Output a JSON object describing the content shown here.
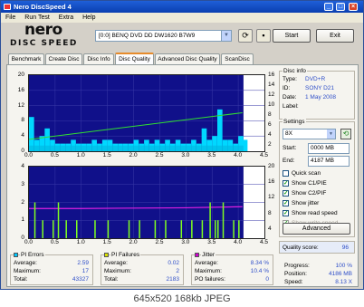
{
  "window": {
    "title": "Nero DiscSpeed 4"
  },
  "menu": [
    "File",
    "Run Test",
    "Extra",
    "Help"
  ],
  "logo": {
    "line1": "nero",
    "line2": "DISC SPEED"
  },
  "toolbar": {
    "drive": "[0:0]  BENQ DVD DD DW1620 B7W9",
    "start_label": "Start",
    "exit_label": "Exit"
  },
  "tabs": [
    {
      "label": "Benchmark"
    },
    {
      "label": "Create Disc"
    },
    {
      "label": "Disc Info"
    },
    {
      "label": "Disc Quality",
      "active": true
    },
    {
      "label": "Advanced Disc Quality"
    },
    {
      "label": "ScanDisc"
    }
  ],
  "disc_info": {
    "title": "Disc info",
    "type_label": "Type:",
    "type_value": "DVD+R",
    "id_label": "ID:",
    "id_value": "SONY D21",
    "date_label": "Date:",
    "date_value": "1 May 2008",
    "label_label": "Label:",
    "label_value": ""
  },
  "settings": {
    "title": "Settings",
    "speed": "8X",
    "start_label": "Start:",
    "start_value": "0000 MB",
    "end_label": "End:",
    "end_value": "4187 MB",
    "checks": [
      {
        "label": "Quick scan",
        "checked": false,
        "dim": false
      },
      {
        "label": "Show C1/PIE",
        "checked": true,
        "dim": false
      },
      {
        "label": "Show C2/PIF",
        "checked": true,
        "dim": false
      },
      {
        "label": "Show jitter",
        "checked": true,
        "dim": false
      },
      {
        "label": "Show read speed",
        "checked": true,
        "dim": false
      },
      {
        "label": "Show write speed",
        "checked": true,
        "dim": true
      }
    ],
    "advanced_label": "Advanced"
  },
  "quality": {
    "label": "Quality score:",
    "value": "96"
  },
  "progress": {
    "progress_label": "Progress:",
    "progress_value": "100 %",
    "position_label": "Position:",
    "position_value": "4186 MB",
    "speed_label": "Speed:",
    "speed_value": "8.13 X"
  },
  "stats": {
    "pi_errors": {
      "title": "PI Errors",
      "color": "#00c8ff",
      "average_label": "Average:",
      "average": "2.59",
      "maximum_label": "Maximum:",
      "maximum": "17",
      "total_label": "Total:",
      "total": "43327"
    },
    "pi_failures": {
      "title": "PI Failures",
      "color": "#d8e000",
      "average_label": "Average:",
      "average": "0.02",
      "maximum_label": "Maximum:",
      "maximum": "2",
      "total_label": "Total:",
      "total": "2183"
    },
    "jitter": {
      "title": "Jitter",
      "color": "#d000d0",
      "average_label": "Average:",
      "average": "8.34 %",
      "maximum_label": "Maximum:",
      "maximum": "10.4 %",
      "po_label": "PO failures:",
      "po": "0"
    }
  },
  "caption": "645x520  168kb  JPEG",
  "chart_data": [
    {
      "type": "bar",
      "name": "PI Errors / read speed",
      "x_ticks": [
        "0.0",
        "0.5",
        "1.0",
        "1.5",
        "2.0",
        "2.5",
        "3.0",
        "3.5",
        "4.0",
        "4.5"
      ],
      "y_left_ticks": [
        "20",
        "16",
        "12",
        "8",
        "4",
        "0"
      ],
      "y_right_ticks": [
        "16",
        "14",
        "12",
        "10",
        "8",
        "6",
        "4",
        "2"
      ],
      "xlim": [
        0,
        4.5
      ],
      "ylim": [
        0,
        20
      ],
      "y2lim": [
        0,
        16
      ],
      "pi_errors_x": [
        0.0,
        0.1,
        0.2,
        0.3,
        0.4,
        0.5,
        0.6,
        0.7,
        0.8,
        0.9,
        1.0,
        1.1,
        1.2,
        1.3,
        1.4,
        1.5,
        1.6,
        1.7,
        1.8,
        1.9,
        2.0,
        2.1,
        2.2,
        2.3,
        2.4,
        2.5,
        2.6,
        2.7,
        2.8,
        2.9,
        3.0,
        3.1,
        3.2,
        3.3,
        3.4,
        3.5,
        3.6,
        3.7,
        3.8,
        3.9,
        4.0,
        4.08
      ],
      "pi_errors_y": [
        9,
        3,
        4,
        6,
        3,
        2,
        2,
        2,
        3,
        2,
        2,
        2,
        3,
        2,
        3,
        3,
        2,
        2,
        2,
        2,
        3,
        2,
        3,
        2,
        3,
        2,
        3,
        2,
        3,
        2,
        2,
        3,
        2,
        6,
        3,
        4,
        11,
        3,
        3,
        2,
        4,
        3
      ],
      "read_speed_x": [
        0.0,
        4.08
      ],
      "read_speed_y": [
        2.5,
        8.1
      ]
    },
    {
      "type": "bar",
      "name": "PI Failures / jitter",
      "x_ticks": [
        "0.0",
        "0.5",
        "1.0",
        "1.5",
        "2.0",
        "2.5",
        "3.0",
        "3.5",
        "4.0",
        "4.5"
      ],
      "y_left_ticks": [
        "4",
        "3",
        "2",
        "1",
        "0"
      ],
      "y_right_ticks": [
        "20",
        "16",
        "12",
        "8",
        "4"
      ],
      "xlim": [
        0,
        4.5
      ],
      "ylim": [
        0,
        4
      ],
      "y2lim": [
        0,
        20
      ],
      "pi_failures_x": [
        0.1,
        0.25,
        0.45,
        0.55,
        0.7,
        0.9,
        1.25,
        1.5,
        1.9,
        2.1,
        2.4,
        2.6,
        2.9,
        3.1,
        3.3,
        3.45,
        3.55,
        3.6,
        3.7,
        3.9,
        4.0
      ],
      "pi_failures_y": [
        2,
        1,
        1,
        2,
        1,
        1,
        1,
        1,
        1,
        1,
        1,
        1,
        1,
        1,
        1,
        2,
        1,
        1,
        2,
        1,
        1
      ],
      "jitter_x": [
        0.0,
        1.0,
        2.0,
        3.0,
        4.08
      ],
      "jitter_y": [
        8.3,
        8.3,
        8.4,
        8.5,
        8.8
      ]
    }
  ]
}
